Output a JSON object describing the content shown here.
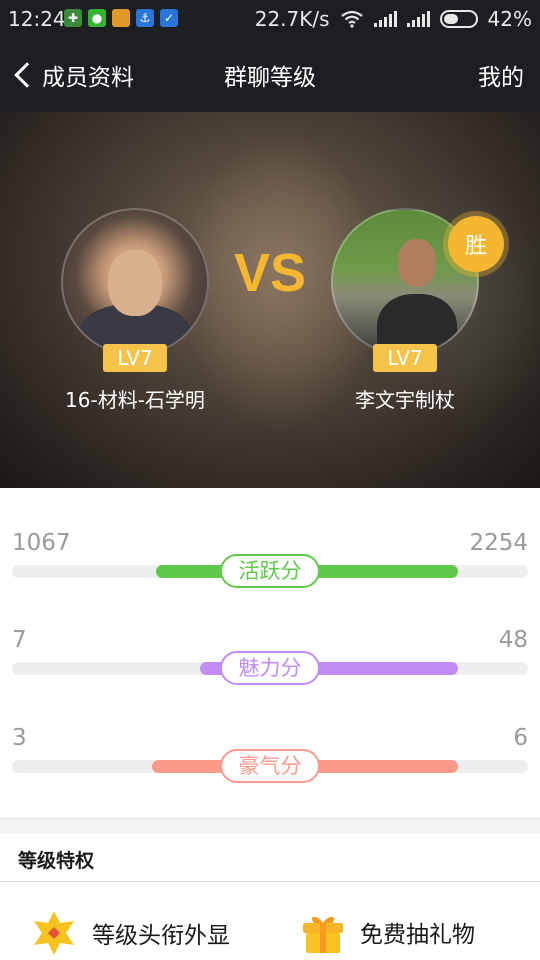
{
  "status_bar": {
    "time": "12:24",
    "net_speed": "22.7K/s",
    "battery": "42%",
    "icons": [
      "shield-icon",
      "wechat-icon",
      "box-icon",
      "anchor-icon",
      "guard-icon",
      "wifi-icon",
      "signal-icon",
      "battery-icon"
    ]
  },
  "nav": {
    "back_label": "成员资料",
    "title": "群聊等级",
    "right_label": "我的"
  },
  "battle": {
    "vs_label": "VS",
    "win_label": "胜",
    "left": {
      "name": "16-材料-石学明",
      "level": "LV7"
    },
    "right": {
      "name": "李文宇制杖",
      "level": "LV7"
    }
  },
  "stats": [
    {
      "label": "活跃分",
      "left": "1067",
      "right": "2254",
      "color": "#5fca4a"
    },
    {
      "label": "魅力分",
      "left": "7",
      "right": "48",
      "color": "#c08ef2"
    },
    {
      "label": "豪气分",
      "left": "3",
      "right": "6",
      "color": "#fa9a8a"
    }
  ],
  "privileges": {
    "header": "等级特权",
    "items": [
      {
        "label": "等级头衔外显",
        "icon": "star-badge-icon"
      },
      {
        "label": "免费抽礼物",
        "icon": "gift-icon"
      }
    ]
  },
  "colors": {
    "accent_gold": "#f5b731",
    "bar_bg": "#1c1e22"
  }
}
